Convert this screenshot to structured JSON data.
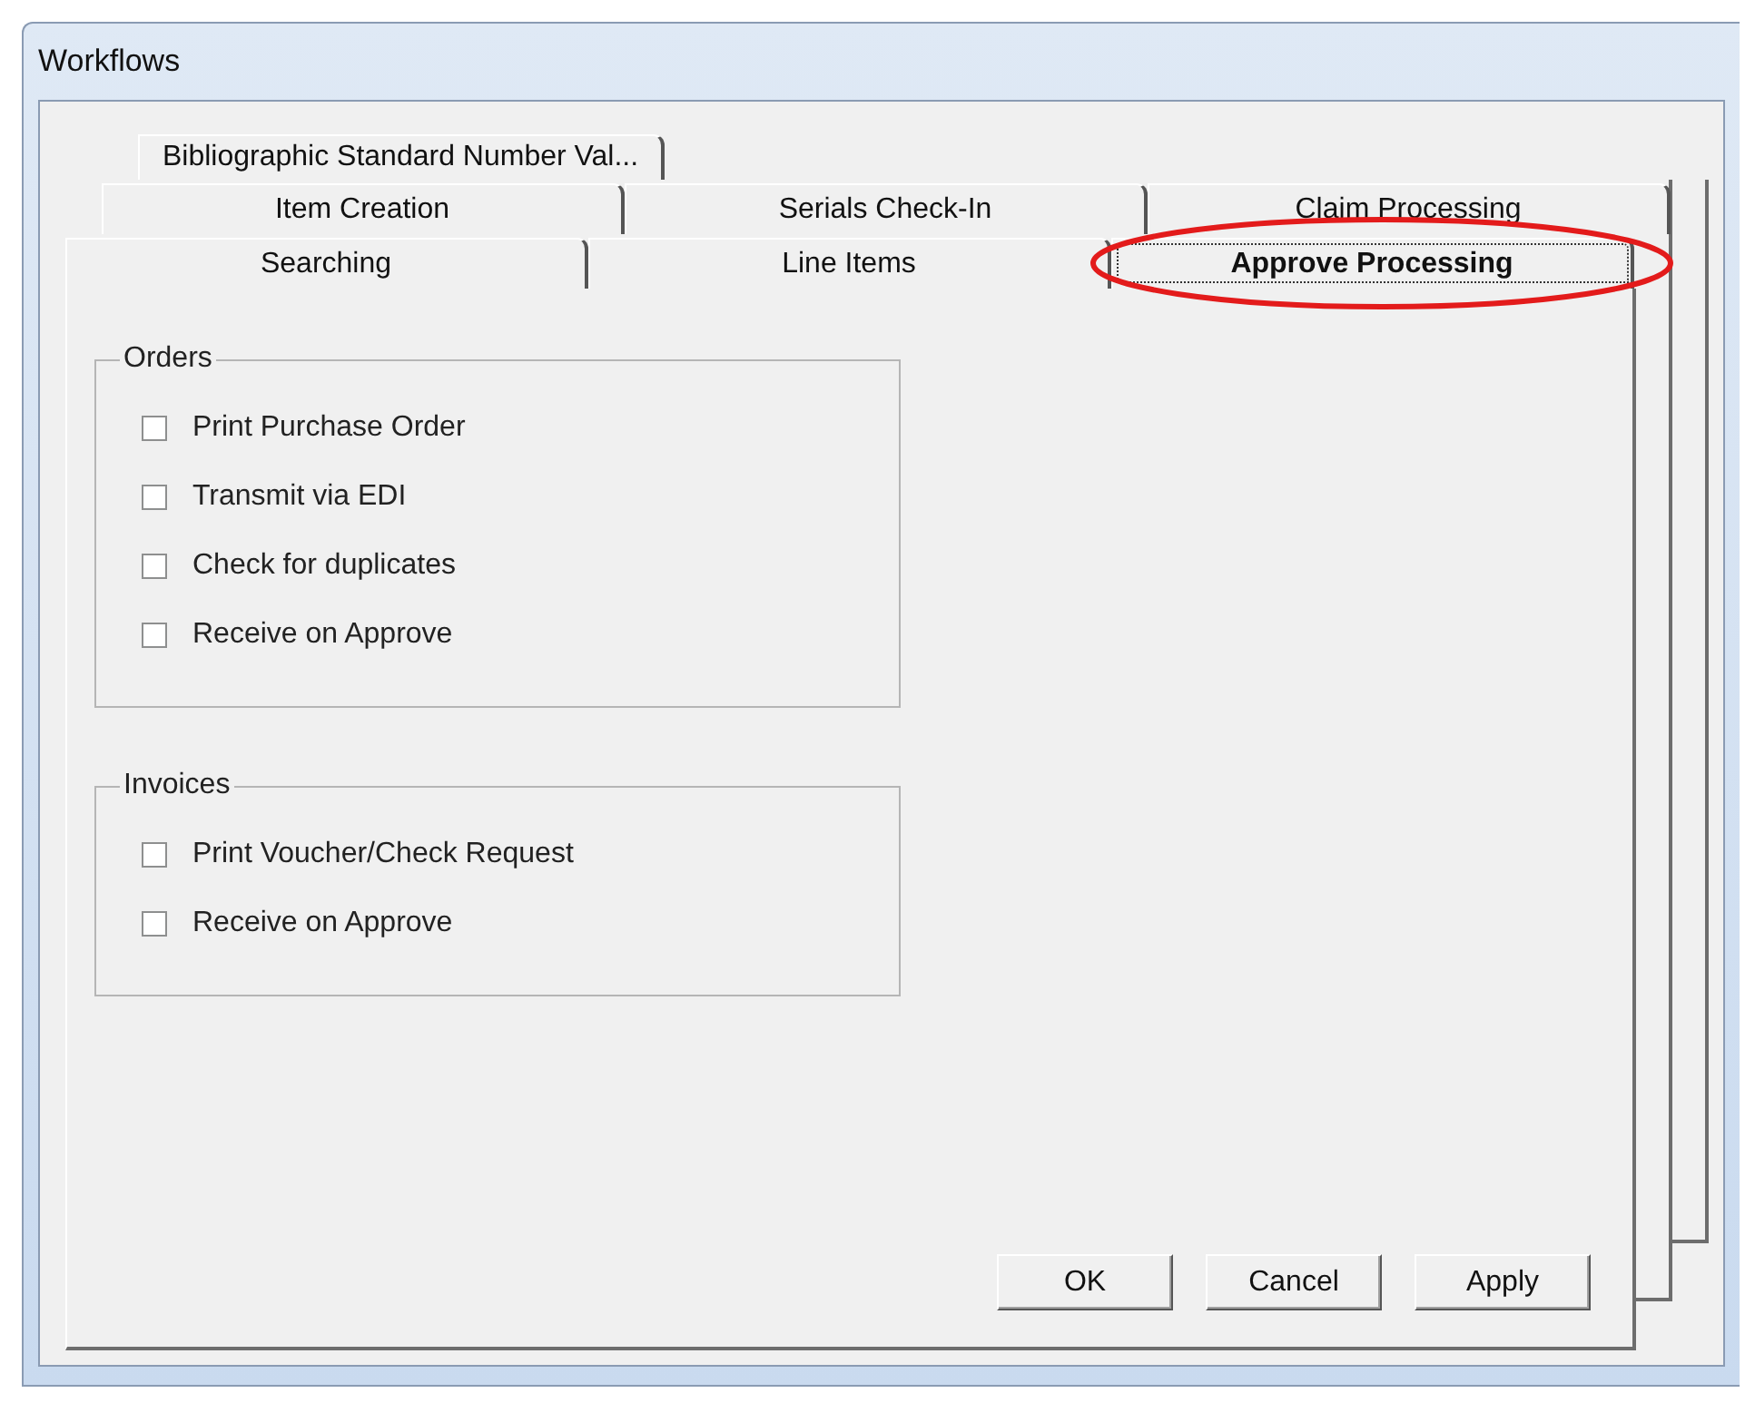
{
  "window": {
    "title": "Workflows"
  },
  "tab_rows": [
    {
      "tabs": [
        {
          "label": "Bibliographic Standard Number Val...",
          "selected": false,
          "highlighted": false
        }
      ]
    },
    {
      "tabs": [
        {
          "label": "Item Creation",
          "selected": false,
          "highlighted": false
        },
        {
          "label": "Serials Check-In",
          "selected": false,
          "highlighted": false
        },
        {
          "label": "Claim Processing",
          "selected": false,
          "highlighted": false
        }
      ]
    },
    {
      "tabs": [
        {
          "label": "Searching",
          "selected": false,
          "highlighted": false
        },
        {
          "label": "Line Items",
          "selected": false,
          "highlighted": false
        },
        {
          "label": "Approve Processing",
          "selected": true,
          "highlighted": true
        }
      ]
    }
  ],
  "groups": [
    {
      "title": "Orders",
      "options": [
        {
          "label": "Print Purchase Order",
          "checked": false
        },
        {
          "label": "Transmit via EDI",
          "checked": false
        },
        {
          "label": "Check for duplicates",
          "checked": false
        },
        {
          "label": "Receive on Approve",
          "checked": false
        }
      ]
    },
    {
      "title": "Invoices",
      "options": [
        {
          "label": "Print Voucher/Check Request",
          "checked": false
        },
        {
          "label": "Receive on Approve",
          "checked": false
        }
      ]
    }
  ],
  "buttons": [
    "OK",
    "Cancel",
    "Apply"
  ]
}
